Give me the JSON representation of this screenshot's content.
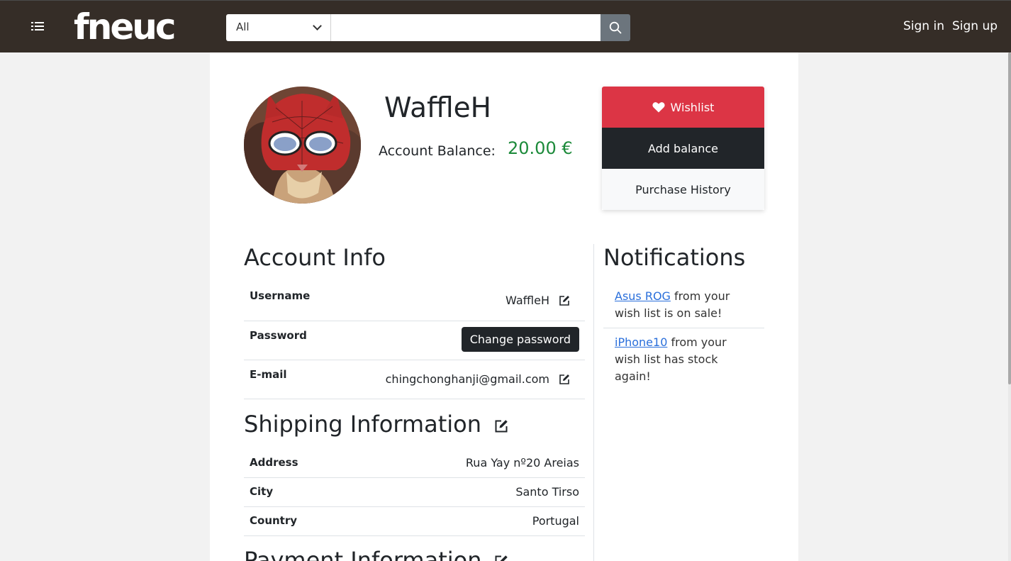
{
  "navbar": {
    "brand": "fneuc",
    "search_category": "All",
    "search_placeholder": "",
    "sign_in": "Sign in",
    "sign_up": "Sign up"
  },
  "profile": {
    "username": "WaffleH",
    "balance_label": "Account Balance:",
    "balance_value": "20.00 €"
  },
  "actions": {
    "wishlist": "Wishlist",
    "add_balance": "Add balance",
    "purchase_history": "Purchase History"
  },
  "account_info": {
    "title": "Account Info",
    "username_label": "Username",
    "username_value": "WaffleH",
    "password_label": "Password",
    "change_password": "Change password",
    "email_label": "E-mail",
    "email_value": "chingchonghanji@gmail.com"
  },
  "shipping": {
    "title": "Shipping Information",
    "address_label": "Address",
    "address_value": "Rua Yay nº20 Areias",
    "city_label": "City",
    "city_value": "Santo Tirso",
    "country_label": "Country",
    "country_value": "Portugal"
  },
  "payment": {
    "title": "Payment Information"
  },
  "notifications": {
    "title": "Notifications",
    "items": [
      {
        "link": "Asus ROG",
        "text": " from your wish list is on sale!"
      },
      {
        "link": "iPhone10",
        "text": " from your wish list has stock again!"
      }
    ]
  },
  "colors": {
    "navbar": "#352d27",
    "wishlist": "#dc3545",
    "dark": "#212529",
    "balance": "#1c8a3a",
    "link": "#2a6fdb"
  }
}
